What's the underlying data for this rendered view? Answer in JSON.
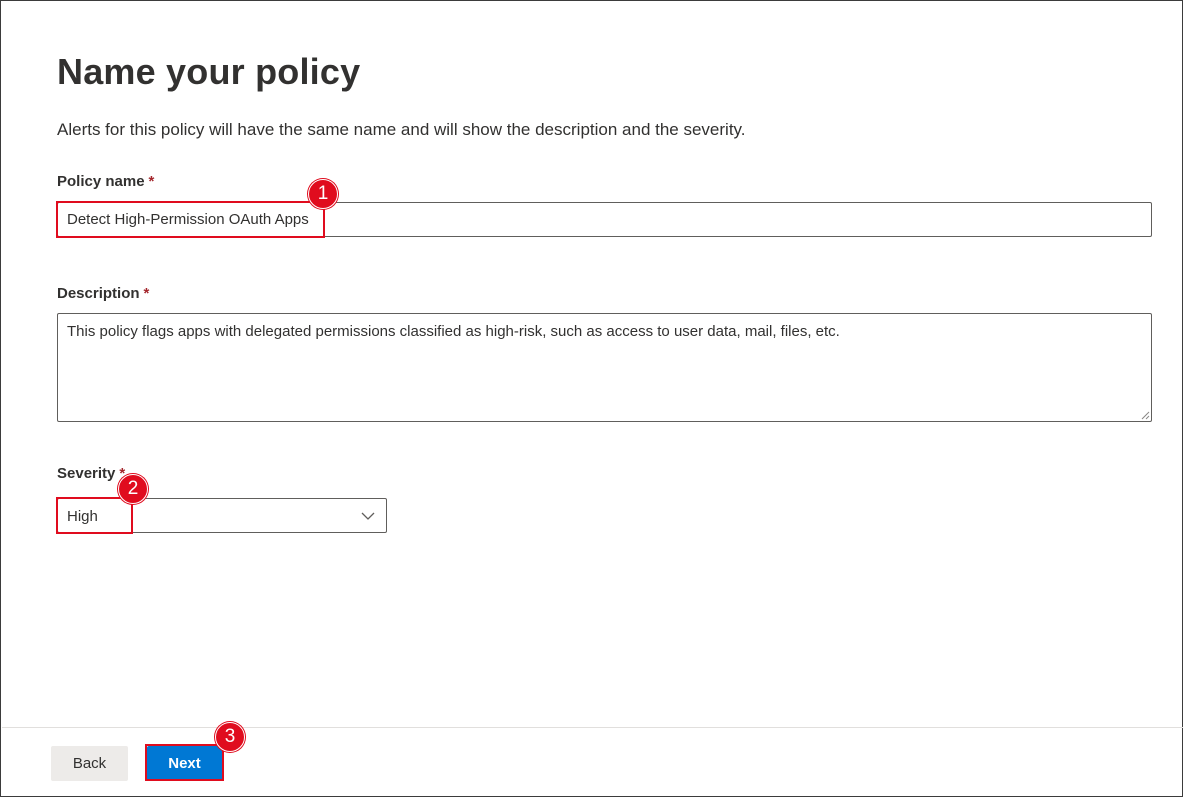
{
  "page": {
    "title": "Name your policy",
    "subtitle": "Alerts for this policy will have the same name and will show the description and the severity."
  },
  "form": {
    "policy_name": {
      "label": "Policy name",
      "required_mark": "*",
      "value": "Detect High-Permission OAuth Apps"
    },
    "description": {
      "label": "Description",
      "required_mark": "*",
      "value": "This policy flags apps with delegated permissions classified as high-risk, such as access to user data, mail, files, etc."
    },
    "severity": {
      "label": "Severity",
      "required_mark": "*",
      "selected": "High",
      "icon": "chevron-down-icon"
    }
  },
  "footer": {
    "back_label": "Back",
    "next_label": "Next"
  },
  "annotations": {
    "markers": [
      "1",
      "2",
      "3"
    ],
    "color": "#e00c1e"
  },
  "colors": {
    "primary": "#0078d4",
    "required": "#a4262c",
    "text": "#323130"
  }
}
